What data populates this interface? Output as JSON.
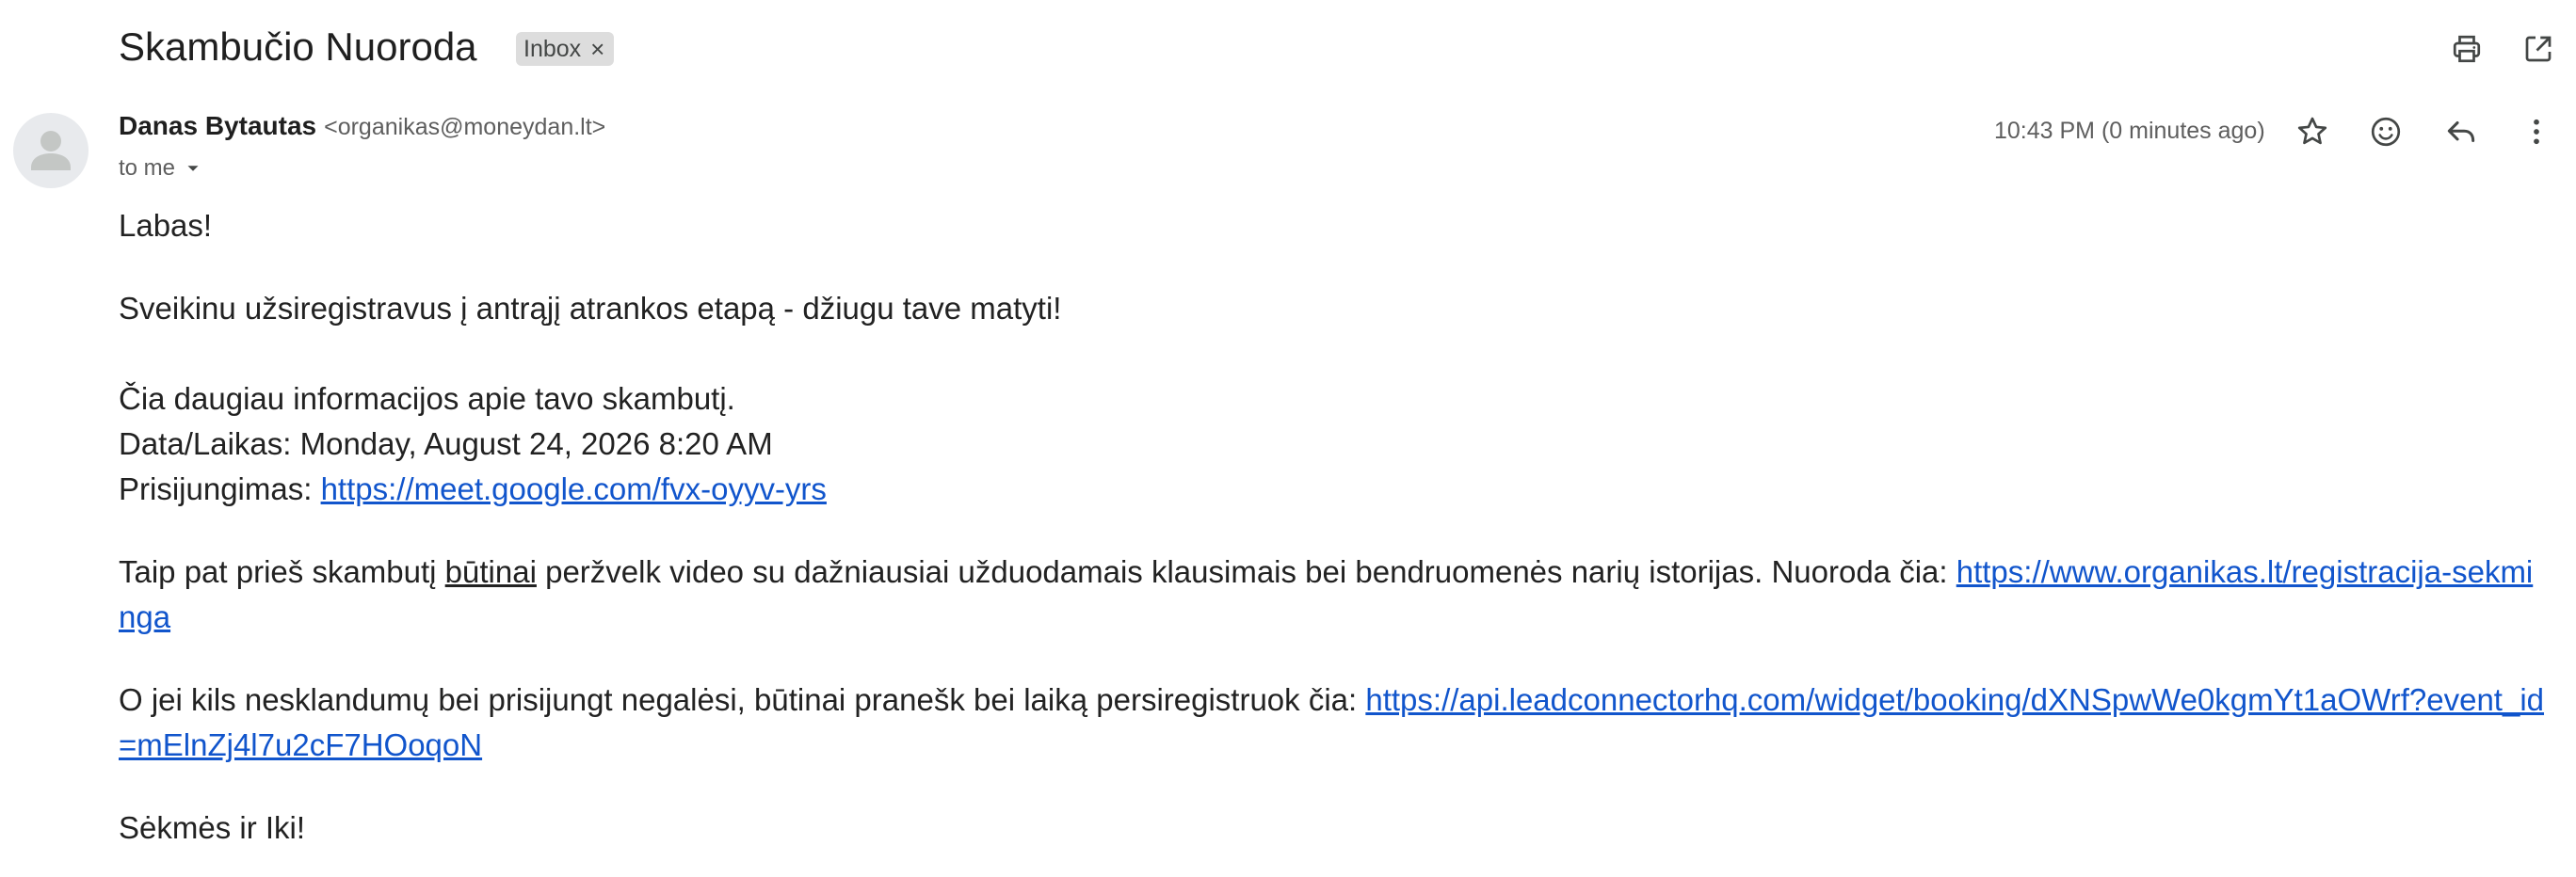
{
  "subject": "Skambučio Nuoroda",
  "label_chip": {
    "text": "Inbox",
    "remove_glyph": "×"
  },
  "toolbar": {
    "print_icon": "printer-icon",
    "open_new_window_icon": "open-in-new-window-icon"
  },
  "sender": {
    "name": "Danas Bytautas",
    "email": "<organikas@moneydan.lt>",
    "recipient": "to me"
  },
  "message_meta": {
    "timestamp": "10:43 PM (0 minutes ago)",
    "star_icon": "star-icon",
    "emoji_icon": "emoji-reaction-icon",
    "reply_icon": "reply-icon",
    "more_icon": "more-vert-icon"
  },
  "body": {
    "greeting": "Labas!",
    "intro": "Sveikinu užsiregistravus į antrąjį atrankos etapą - džiugu tave matyti!",
    "info_line": "Čia daugiau informacijos apie tavo skambutį.",
    "datetime_label": "Data/Laikas:",
    "datetime_value": "Monday, August 24, 2026 8:20 AM",
    "join_label": "Prisijungimas:",
    "join_link": "https://meet.google.com/fvx-oyyv-yrs",
    "review_before": "Taip pat prieš skambutį",
    "review_emphasis": "būtinai",
    "review_after": "peržvelk video su dažniausiai užduodamais klausimais bei bendruomenės narių istorijas. Nuoroda čia:",
    "review_link": "https://www.organikas.lt/registracija-sekminga",
    "issues_text": "O jei kils nesklandumų bei prisijungt negalėsi, būtinai pranešk bei laiką persiregistruok čia:",
    "issues_link": "https://api.leadconnectorhq.com/widget/booking/dXNSpwWe0kgmYt1aOWrf?event_id=mElnZj4l7u2cF7HOoqoN",
    "signoff": "Sėkmės ir Iki!"
  },
  "colors": {
    "link": "#1155cc",
    "text": "#222222",
    "muted": "#5e5e5e",
    "chip_bg": "#dddddd",
    "icon": "#444746"
  }
}
